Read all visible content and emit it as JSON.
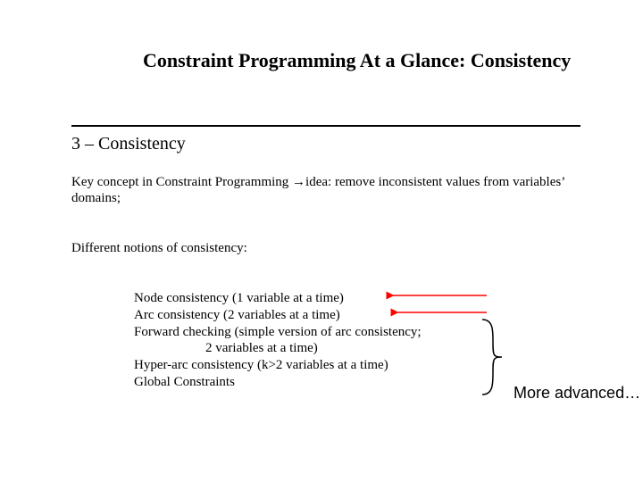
{
  "title": "Constraint Programming At a Glance: Consistency",
  "subtitle": "3 – Consistency",
  "paragraphs": {
    "p1_a": "Key concept in Constraint Programming ",
    "p1_arrow": "→",
    "p1_b": "idea: remove inconsistent values from variables’ domains;",
    "p2": "Different notions of consistency:"
  },
  "list": {
    "i1": "Node consistency (1 variable at a time)",
    "i2": "Arc consistency (2 variables at a time)",
    "i3": "Forward checking (simple version of arc consistency;",
    "i3b": "2 variables at a time)",
    "i4": "Hyper-arc consistency (k>2 variables at a time)",
    "i5": "Global Constraints"
  },
  "more_label": "More advanced…"
}
